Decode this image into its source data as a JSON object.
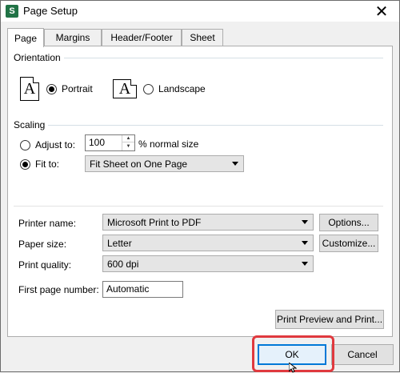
{
  "window": {
    "title": "Page Setup",
    "app_icon_letter": "S",
    "close_glyph": "✕"
  },
  "tabs": [
    {
      "label": "Page",
      "active": true
    },
    {
      "label": "Margins"
    },
    {
      "label": "Header/Footer"
    },
    {
      "label": "Sheet"
    }
  ],
  "orientation": {
    "group_label": "Orientation",
    "portrait_label": "Portrait",
    "landscape_label": "Landscape",
    "selected": "Portrait",
    "icon_letter": "A"
  },
  "scaling": {
    "group_label": "Scaling",
    "adjust_label": "Adjust to:",
    "adjust_value": "100",
    "adjust_suffix": "% normal size",
    "fit_label": "Fit to:",
    "fit_value": "Fit Sheet on One Page",
    "selected": "Fit to:"
  },
  "printer": {
    "name_label": "Printer name:",
    "name_value": "Microsoft Print to PDF",
    "options_button": "Options...",
    "paper_label": "Paper size:",
    "paper_value": "Letter",
    "customize_button": "Customize...",
    "quality_label": "Print quality:",
    "quality_value": "600 dpi",
    "first_page_label": "First page number:",
    "first_page_value": "Automatic",
    "preview_button": "Print Preview and Print..."
  },
  "footer": {
    "ok_label": "OK",
    "cancel_label": "Cancel"
  },
  "colors": {
    "accent": "#0078d7",
    "highlight": "#e0393e",
    "app_icon": "#217346"
  }
}
